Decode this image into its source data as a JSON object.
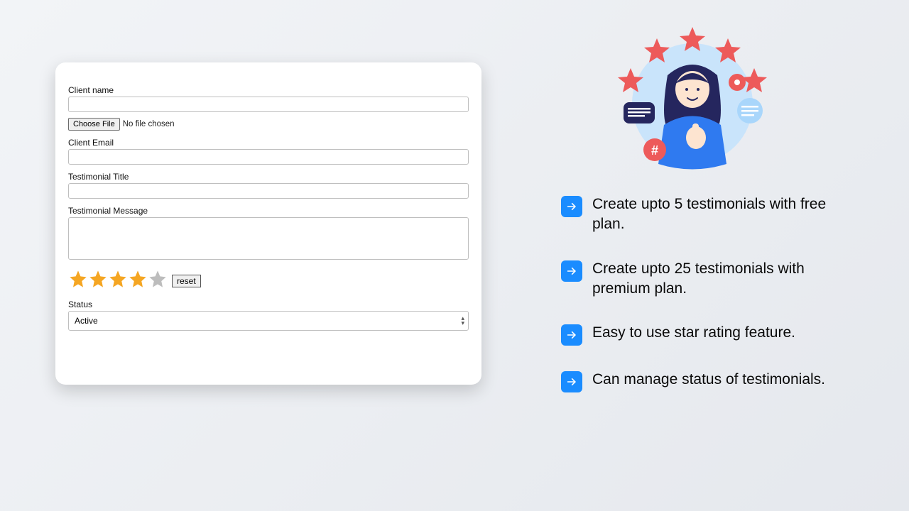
{
  "form": {
    "client_name_label": "Client name",
    "client_name_value": "",
    "choose_file_label": "Choose File",
    "file_status": "No file chosen",
    "client_email_label": "Client Email",
    "client_email_value": "",
    "title_label": "Testimonial Title",
    "title_value": "",
    "message_label": "Testimonial Message",
    "message_value": "",
    "rating": 4,
    "reset_label": "reset",
    "status_label": "Status",
    "status_value": "Active"
  },
  "features": [
    "Create upto 5 testimonials with free plan.",
    "Create upto 25 testimonials with premium plan.",
    "Easy to use star rating feature.",
    "Can manage status of testimonials."
  ],
  "colors": {
    "star_filled": "#f5a623",
    "star_empty": "#bdbdbd",
    "accent": "#1a8cff",
    "illustration_blue": "#2f7af0",
    "illustration_red": "#ed5a5a",
    "illustration_navy": "#25265e"
  }
}
